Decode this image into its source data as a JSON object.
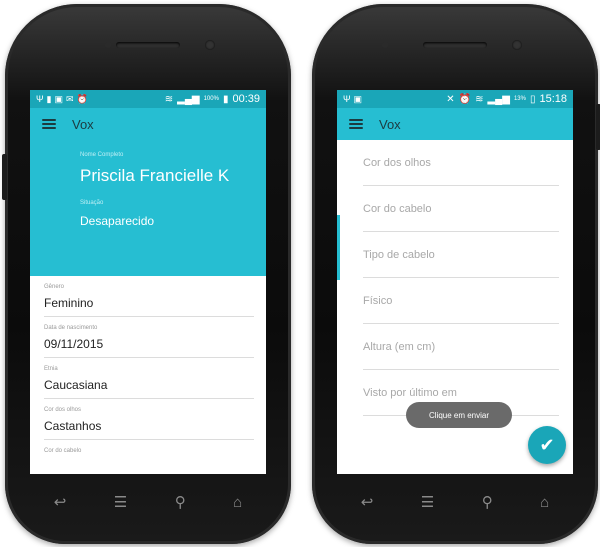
{
  "left": {
    "status": {
      "battery_pct": "100%",
      "time": "00:39"
    },
    "app_title": "Vox",
    "header": {
      "name_label": "Nome Completo",
      "name": "Priscila Francielle K",
      "status_label": "Situação",
      "status": "Desaparecido"
    },
    "fields": [
      {
        "label": "Gênero",
        "value": "Feminino"
      },
      {
        "label": "Data de nascimento",
        "value": "09/11/2015"
      },
      {
        "label": "Etnia",
        "value": "Caucasiana"
      },
      {
        "label": "Cor dos olhos",
        "value": "Castanhos"
      },
      {
        "label": "Cor do cabelo",
        "value": ""
      }
    ]
  },
  "right": {
    "status": {
      "battery_pct": "13%",
      "time": "15:18"
    },
    "app_title": "Vox",
    "placeholders": [
      "Cor dos olhos",
      "Cor do cabelo",
      "Tipo de cabelo",
      "Físico",
      "Altura (em cm)",
      "Visto por último em"
    ],
    "toast": "Clique em enviar",
    "fab_icon": "check-icon"
  },
  "colors": {
    "accent": "#26bed2",
    "statusbar": "#1aa6b8"
  }
}
